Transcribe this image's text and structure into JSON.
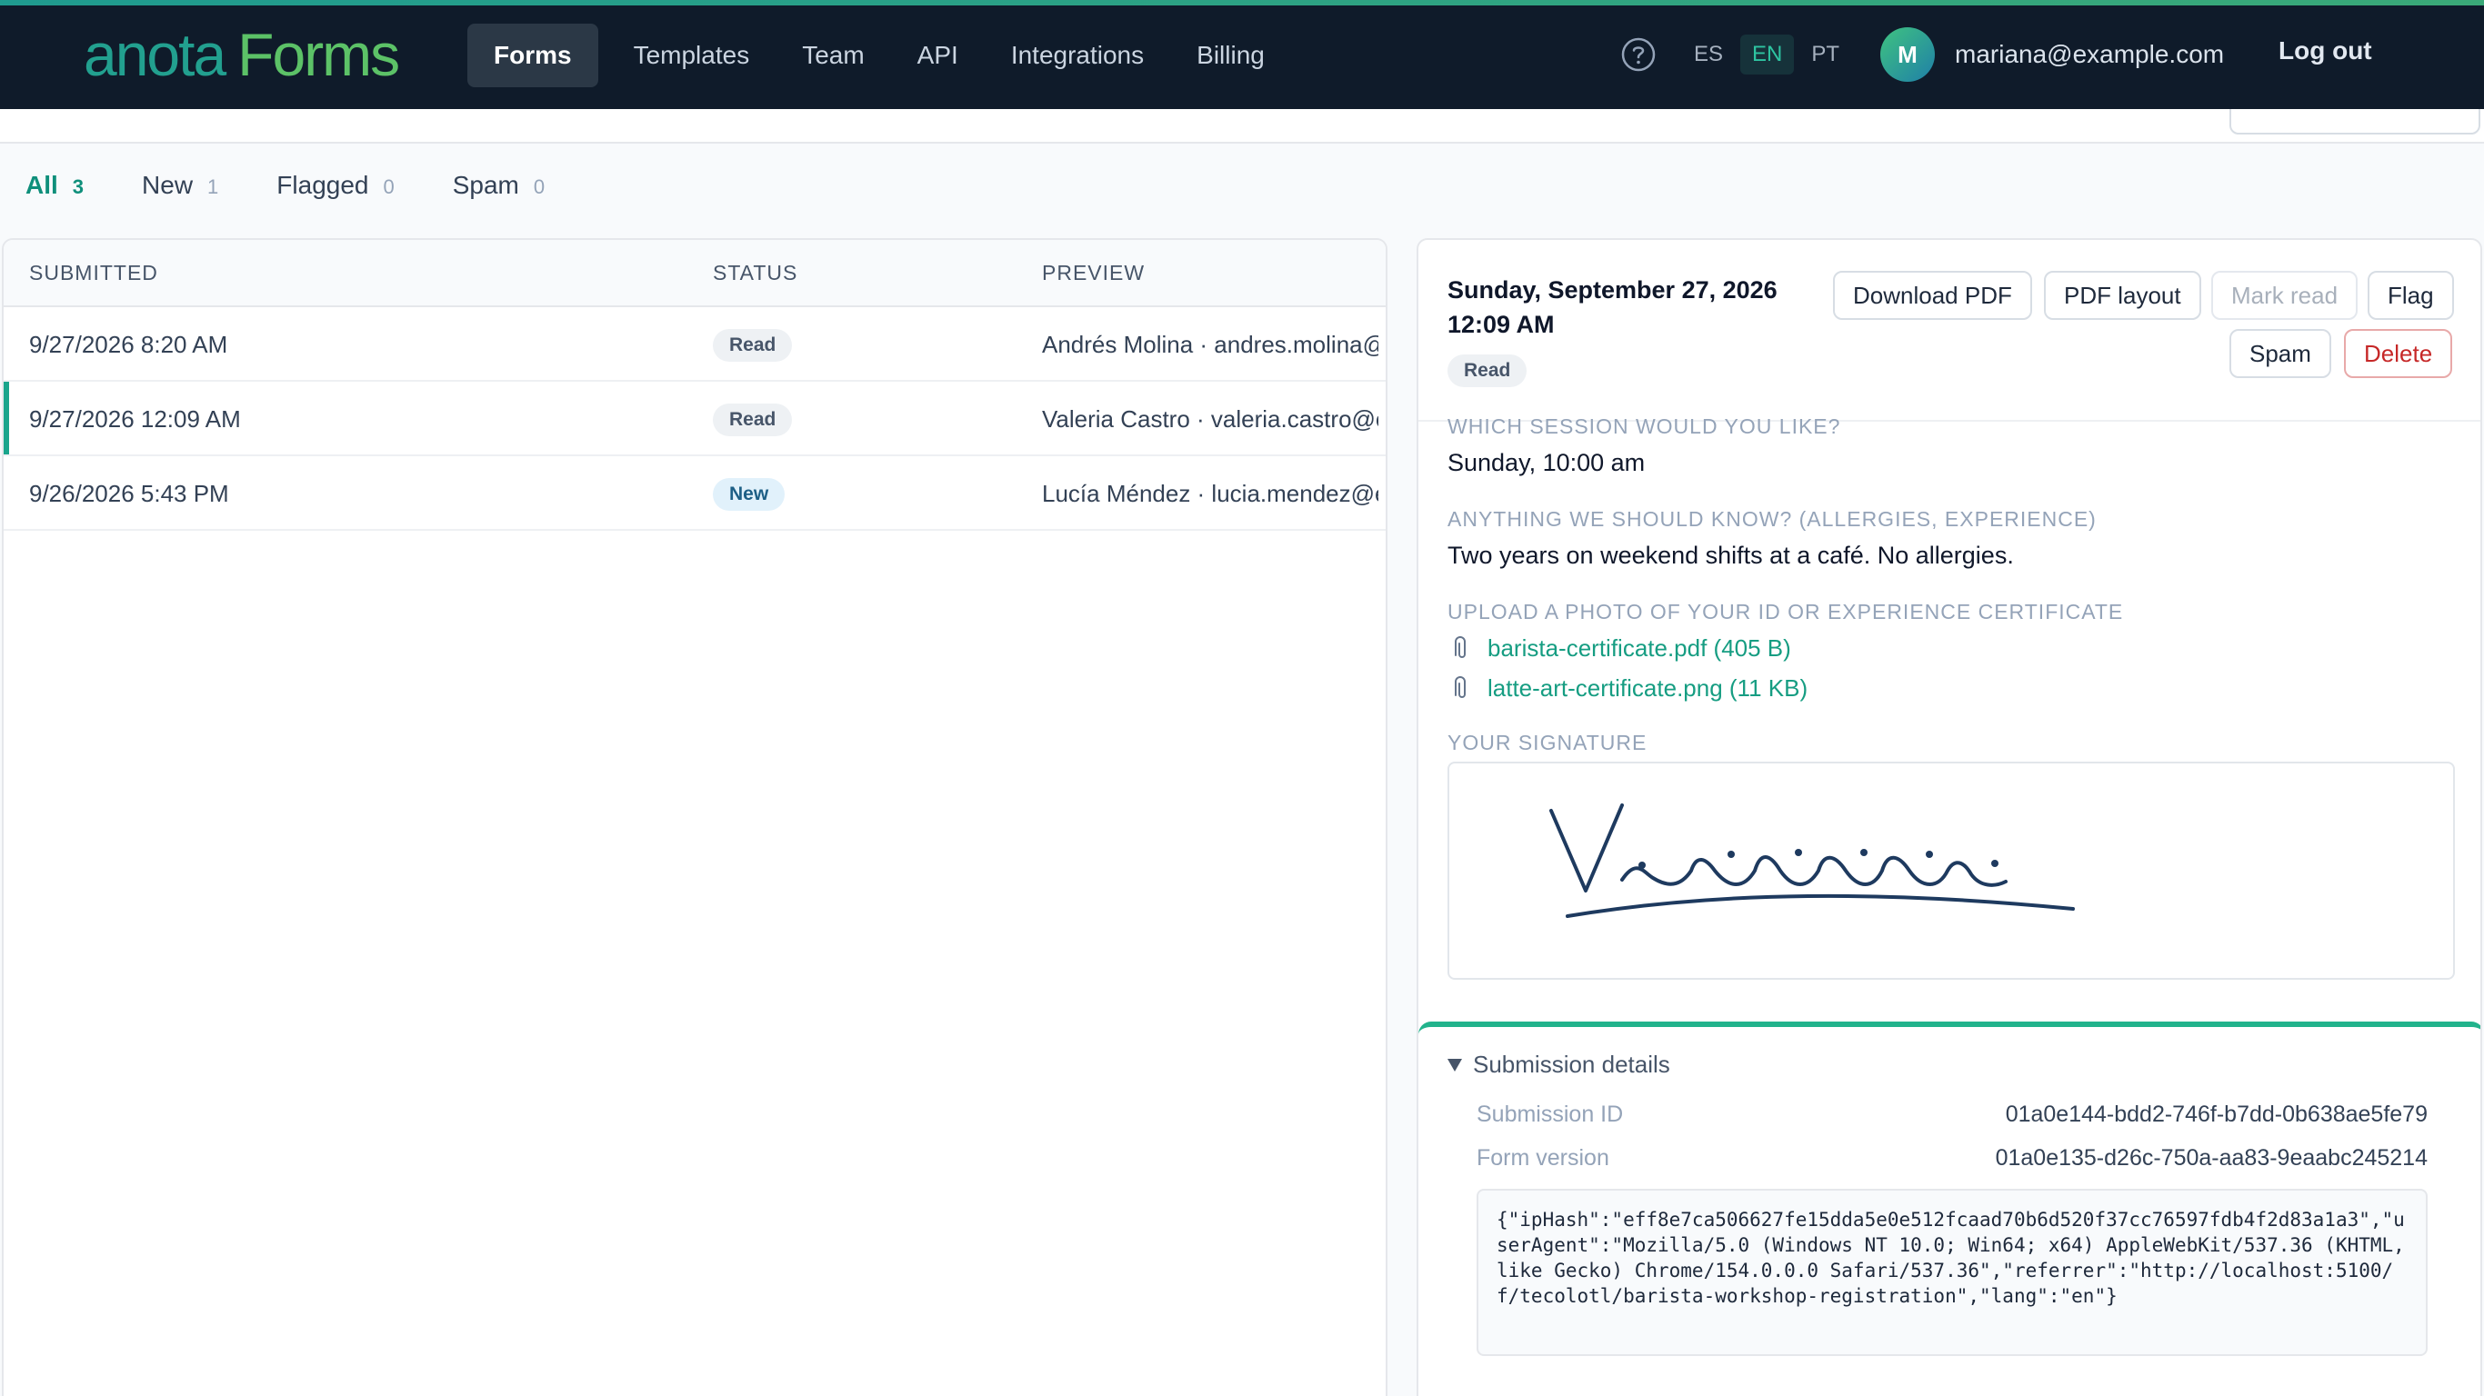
{
  "app": {
    "logo_part1": "anota",
    "logo_part2": "Forms"
  },
  "nav": {
    "items": [
      {
        "label": "Forms",
        "active": true
      },
      {
        "label": "Templates"
      },
      {
        "label": "Team"
      },
      {
        "label": "API"
      },
      {
        "label": "Integrations"
      },
      {
        "label": "Billing"
      }
    ],
    "help_icon": "help-circle-icon",
    "languages": [
      {
        "label": "ES"
      },
      {
        "label": "EN",
        "active": true
      },
      {
        "label": "PT"
      }
    ],
    "avatar_initial": "M",
    "user_email": "mariana@example.com",
    "logout_label": "Log out"
  },
  "filters": [
    {
      "label": "All",
      "count": "3",
      "active": true
    },
    {
      "label": "New",
      "count": "1"
    },
    {
      "label": "Flagged",
      "count": "0"
    },
    {
      "label": "Spam",
      "count": "0"
    }
  ],
  "table": {
    "headers": {
      "submitted": "SUBMITTED",
      "status": "STATUS",
      "preview": "PREVIEW"
    },
    "rows": [
      {
        "submitted": "9/27/2026 8:20 AM",
        "status": "Read",
        "preview": "Andrés Molina · andres.molina@example.com"
      },
      {
        "submitted": "9/27/2026 12:09 AM",
        "status": "Read",
        "preview": "Valeria Castro · valeria.castro@example.com",
        "selected": true
      },
      {
        "submitted": "9/26/2026 5:43 PM",
        "status": "New",
        "preview": "Lucía Méndez · lucia.mendez@example.com"
      }
    ]
  },
  "detail": {
    "date_line1": "Sunday, September 27, 2026",
    "date_line2": "12:09 AM",
    "status": "Read",
    "buttons": {
      "download_pdf": "Download PDF",
      "pdf_layout": "PDF layout",
      "mark_read": "Mark read",
      "flag": "Flag",
      "spam": "Spam",
      "delete": "Delete"
    },
    "fields": [
      {
        "label": "WHICH SESSION WOULD YOU LIKE?",
        "value": "Sunday, 10:00 am"
      },
      {
        "label": "ANYTHING WE SHOULD KNOW? (ALLERGIES, EXPERIENCE)",
        "value": "Two years on weekend shifts at a café. No allergies."
      }
    ],
    "upload_label": "UPLOAD A PHOTO OF YOUR ID OR EXPERIENCE CERTIFICATE",
    "files": [
      {
        "name": "barista-certificate.pdf (405 B)",
        "icon": "paperclip-icon"
      },
      {
        "name": "latte-art-certificate.png (11 KB)",
        "icon": "paperclip-icon"
      }
    ],
    "signature_label": "YOUR SIGNATURE"
  },
  "submission_details": {
    "toggle_label": "Submission details",
    "submission_id_label": "Submission ID",
    "submission_id": "01a0e144-bdd2-746f-b7dd-0b638ae5fe79",
    "form_version_label": "Form version",
    "form_version": "01a0e135-d26c-750a-aa83-9eaabc245214",
    "meta_json": "{\"ipHash\":\"eff8e7ca506627fe15dda5e0e512fcaad70b6d520f37cc76597fdb4f2d83a1a3\",\"userAgent\":\"Mozilla/5.0 (Windows NT 10.0; Win64; x64) AppleWebKit/537.36 (KHTML, like Gecko) Chrome/154.0.0.0 Safari/537.36\",\"referrer\":\"http://localhost:5100/f/tecolotl/barista-workshop-registration\",\"lang\":\"en\"}"
  },
  "colors": {
    "topbar": "#0f1b2a",
    "accent": "#1aa58c",
    "danger": "#c62828"
  }
}
